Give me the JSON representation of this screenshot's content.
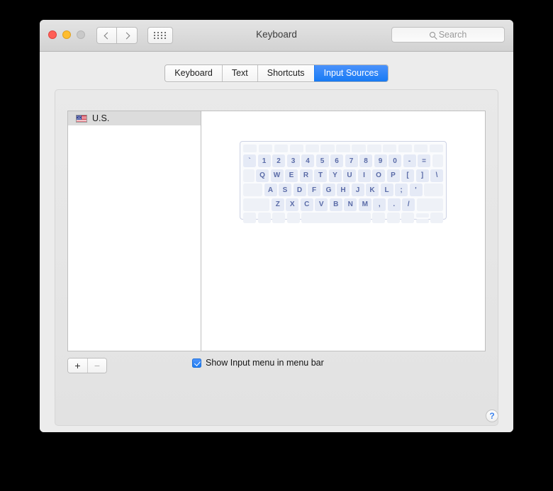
{
  "window": {
    "title": "Keyboard",
    "traffic_lights": [
      "close",
      "minimize",
      "zoom"
    ],
    "nav": {
      "back": "‹",
      "forward": "›",
      "grid": "show-all"
    },
    "search": {
      "value": "",
      "placeholder": "Search"
    }
  },
  "tabs": [
    {
      "label": "Keyboard",
      "active": false
    },
    {
      "label": "Text",
      "active": false
    },
    {
      "label": "Shortcuts",
      "active": false
    },
    {
      "label": "Input Sources",
      "active": true
    }
  ],
  "input_sources": {
    "items": [
      {
        "label": "U.S.",
        "flag": "us-flag-icon",
        "selected": true
      }
    ],
    "add_label": "+",
    "remove_label": "−"
  },
  "keyboard_preview": {
    "rows": [
      {
        "type": "function",
        "keys": [
          "",
          "",
          "",
          "",
          "",
          "",
          "",
          "",
          "",
          "",
          "",
          "",
          ""
        ]
      },
      {
        "type": "number",
        "keys": [
          "`",
          "1",
          "2",
          "3",
          "4",
          "5",
          "6",
          "7",
          "8",
          "9",
          "0",
          "-",
          "=",
          ""
        ]
      },
      {
        "type": "upper",
        "keys": [
          "",
          "Q",
          "W",
          "E",
          "R",
          "T",
          "Y",
          "U",
          "I",
          "O",
          "P",
          "[",
          "]",
          "\\"
        ]
      },
      {
        "type": "home",
        "keys": [
          "",
          "A",
          "S",
          "D",
          "F",
          "G",
          "H",
          "J",
          "K",
          "L",
          ";",
          "'",
          ""
        ]
      },
      {
        "type": "lower",
        "keys": [
          "",
          "Z",
          "X",
          "C",
          "V",
          "B",
          "N",
          "M",
          ",",
          ".",
          "/",
          ""
        ]
      },
      {
        "type": "modifier",
        "keys": [
          "",
          "",
          "",
          "",
          "",
          "",
          "",
          ""
        ]
      }
    ]
  },
  "options": {
    "show_input_menu": {
      "label": "Show Input menu in menu bar",
      "checked": true
    }
  },
  "help": {
    "label": "?"
  },
  "colors": {
    "accent": "#187bf4",
    "key_glyph": "#5a6ba7",
    "key_face": "#e5eaf6",
    "window_chrome": "#ececec"
  }
}
